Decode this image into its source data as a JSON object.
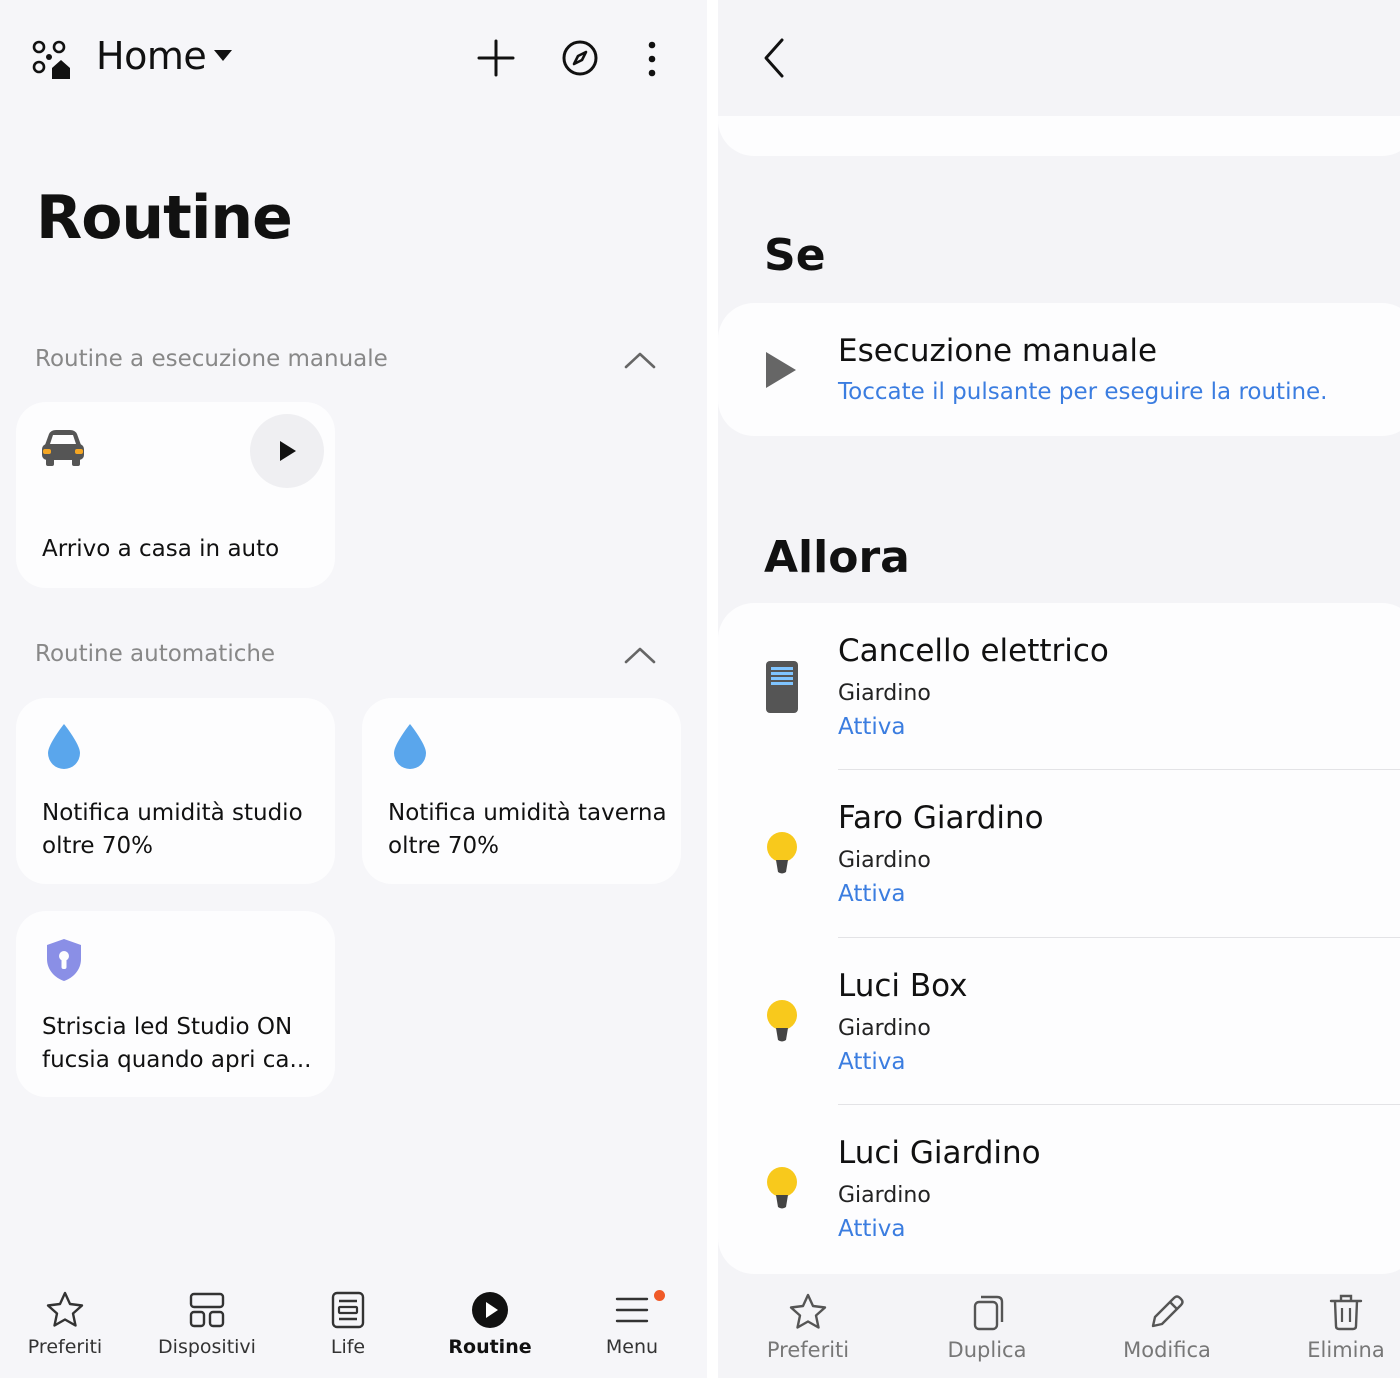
{
  "left": {
    "header": {
      "title": "Home"
    },
    "page_title": "Routine",
    "sections": {
      "manual": "Routine a esecuzione manuale",
      "auto": "Routine automatiche"
    },
    "manual_cards": [
      {
        "label": "Arrivo a casa in auto",
        "icon": "car-icon"
      }
    ],
    "auto_cards": [
      {
        "line1": "Notifica umidità studio",
        "line2": "oltre 70%",
        "icon": "water-drop-icon"
      },
      {
        "line1": "Notifica umidità taverna",
        "line2": "oltre 70%",
        "icon": "water-drop-icon"
      },
      {
        "line1": "Striscia led Studio ON",
        "line2": "fucsia quando apri ca...",
        "icon": "security-shield-icon"
      }
    ],
    "bottom_nav": [
      {
        "label": "Preferiti",
        "icon": "star-icon"
      },
      {
        "label": "Dispositivi",
        "icon": "devices-grid-icon"
      },
      {
        "label": "Life",
        "icon": "life-icon"
      },
      {
        "label": "Routine",
        "icon": "routine-play-icon",
        "active": true
      },
      {
        "label": "Menu",
        "icon": "menu-icon",
        "badge": true
      }
    ],
    "colors": {
      "accent_blue": "#5aa6ec",
      "shield": "#8a8fe6",
      "badge": "#f05a28",
      "car_light": "#f5a623"
    }
  },
  "right": {
    "if_title": "Se",
    "trigger": {
      "title": "Esecuzione manuale",
      "description": "Toccate il pulsante per eseguire la routine."
    },
    "then_title": "Allora",
    "actions": [
      {
        "name": "Cancello elettrico",
        "room": "Giardino",
        "status": "Attiva",
        "icon": "gate-device-icon"
      },
      {
        "name": "Faro Giardino",
        "room": "Giardino",
        "status": "Attiva",
        "icon": "light-bulb-icon"
      },
      {
        "name": "Luci Box",
        "room": "Giardino",
        "status": "Attiva",
        "icon": "light-bulb-icon"
      },
      {
        "name": "Luci Giardino",
        "room": "Giardino",
        "status": "Attiva",
        "icon": "light-bulb-icon"
      }
    ],
    "bottom_actions": [
      {
        "label": "Preferiti",
        "icon": "star-icon"
      },
      {
        "label": "Duplica",
        "icon": "duplicate-icon"
      },
      {
        "label": "Modifica",
        "icon": "pencil-icon"
      },
      {
        "label": "Elimina",
        "icon": "trash-icon"
      }
    ],
    "colors": {
      "link_blue": "#3b7de0",
      "bulb_yellow": "#f8c91c"
    }
  }
}
